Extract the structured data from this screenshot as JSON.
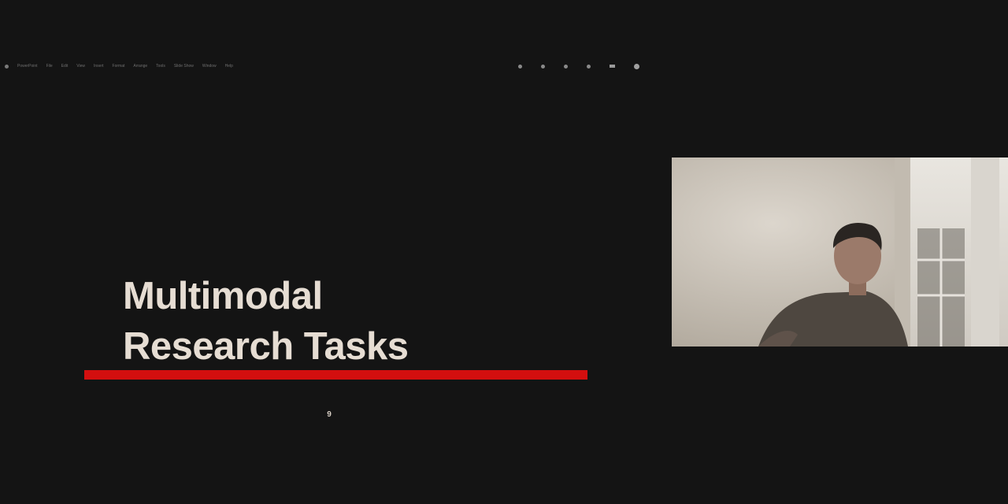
{
  "menubar": {
    "app_name": "PowerPoint",
    "items": [
      "File",
      "Edit",
      "View",
      "Insert",
      "Format",
      "Arrange",
      "Tools",
      "Slide Show",
      "Window",
      "Help"
    ]
  },
  "slide": {
    "title_line_1": "Multimodal",
    "title_line_2": "Research Tasks",
    "page_number": "9"
  },
  "colors": {
    "background": "#141414",
    "title_text": "#e6ddd3",
    "accent_underline": "#d30f0f"
  }
}
